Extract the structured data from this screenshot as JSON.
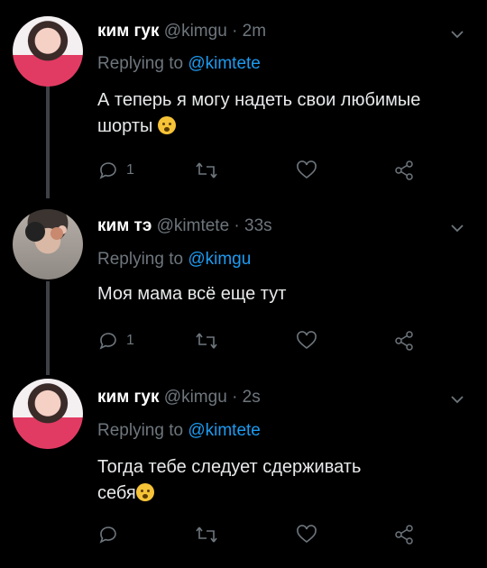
{
  "tweets": [
    {
      "name": "ким гук",
      "handle": "@kimgu",
      "time": "· 2m",
      "replying_prefix": "Replying to",
      "replying_to": "@kimtete",
      "text": "А теперь я могу надеть свои любимые шорты",
      "reply_count": "1",
      "avatar": "avatar-pink"
    },
    {
      "name": "ким тэ",
      "handle": "@kimtete",
      "time": "· 33s",
      "replying_prefix": "Replying to",
      "replying_to": "@kimgu",
      "text": "Моя мама всё еще тут",
      "reply_count": "1",
      "avatar": "avatar-grey"
    },
    {
      "name": "ким гук",
      "handle": "@kimgu",
      "time": "· 2s",
      "replying_prefix": "Replying to",
      "replying_to": "@kimtete",
      "text_line1": "Тогда тебе следует сдерживать",
      "text_line2": "себя",
      "reply_count": "",
      "avatar": "avatar-pink"
    }
  ],
  "colors": {
    "background": "#000000",
    "link": "#1d9bf0",
    "muted": "#6e767d",
    "thread_line": "#3d4146"
  },
  "icons": [
    "chevron-down-icon",
    "reply-icon",
    "retweet-icon",
    "like-icon",
    "share-icon",
    "flushed-emoji-icon"
  ]
}
